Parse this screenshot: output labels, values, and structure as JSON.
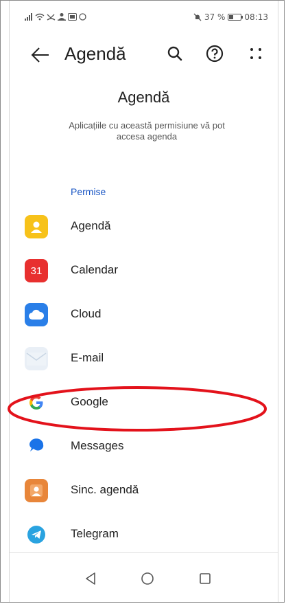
{
  "status_bar": {
    "left_icons": [
      "signal-icon",
      "wifi-icon",
      "missed-call-icon",
      "user-icon",
      "nfc-icon",
      "circle-icon"
    ],
    "mute_icon": "bell-muted-icon",
    "battery_percent": "37 %",
    "time": "08:13"
  },
  "toolbar": {
    "title": "Agendă",
    "back_icon": "arrow-left-icon",
    "search_icon": "search-icon",
    "help_icon": "question-icon",
    "more_icon": "more-dots-icon"
  },
  "header": {
    "heading": "Agendă",
    "description": "Aplicațiile cu această permisiune vă pot accesa agenda"
  },
  "section": {
    "label": "Permise"
  },
  "apps": [
    {
      "label": "Agendă",
      "icon": "contacts-icon",
      "color": "#f7c21a"
    },
    {
      "label": "Calendar",
      "icon": "calendar-icon",
      "badge": "31",
      "color": "#e8302f"
    },
    {
      "label": "Cloud",
      "icon": "cloud-icon",
      "color": "#2a7fe8"
    },
    {
      "label": "E-mail",
      "icon": "mail-icon",
      "color": "#e6edf5"
    },
    {
      "label": "Google",
      "icon": "google-icon",
      "color": "#4285f4"
    },
    {
      "label": "Messages",
      "icon": "messages-icon",
      "color": "#1a73e8"
    },
    {
      "label": "Sinc. agendă",
      "icon": "contacts-sync-icon",
      "color": "#e8863a"
    },
    {
      "label": "Telegram",
      "icon": "telegram-icon",
      "color": "#2aa3e0"
    }
  ],
  "navbar": {
    "back_icon": "nav-back-icon",
    "home_icon": "nav-home-icon",
    "recent_icon": "nav-recent-icon"
  },
  "annotation": {
    "highlight_color": "#e3121b",
    "target": "Google"
  }
}
